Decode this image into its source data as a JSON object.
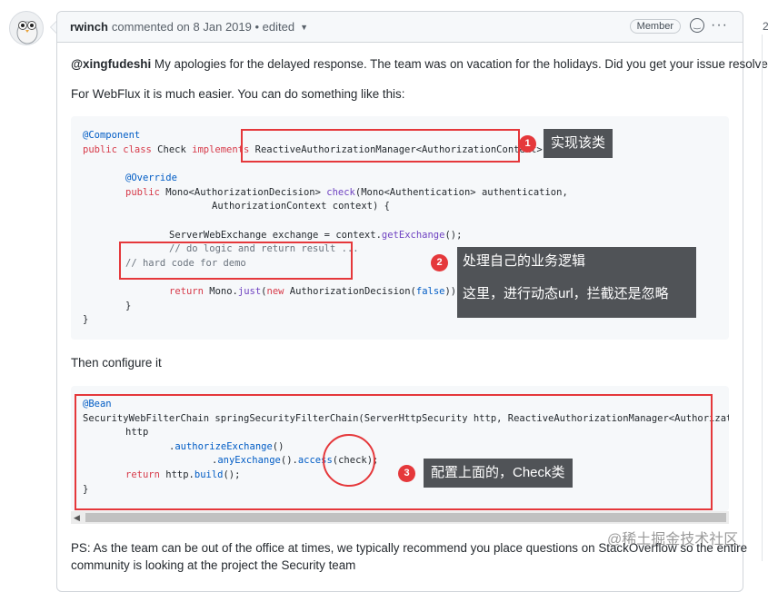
{
  "comment": {
    "author": "rwinch",
    "action": "commented on",
    "date": "8 Jan 2019",
    "edited": "• edited",
    "badge": "Member",
    "emoji_icon": "smiley-icon",
    "more_icon": "kebab-icon"
  },
  "body": {
    "p1_mention": "@xingfudeshi",
    "p1_text": " My apologies for the delayed response. The team was on vacation for the holidays. Did you get your issue resolved?",
    "p2": "For WebFlux it is much easier. You can do something like this:",
    "p3": "Then configure it",
    "p4_line1": "PS: As the team can be out of the office at times, we typically recommend you place questions on StackOverflow so the entire",
    "p4_line2": "community is looking at the project the Security team"
  },
  "code1": {
    "l1_anno": "@Component",
    "l2_kw": "public class",
    "l2_name": " Check ",
    "l2_impl": "implements",
    "l2_type": " ReactiveAuthorizationManager<AuthorizationContext> {",
    "l4_anno": "@Override",
    "l5_kw": "public",
    "l5_a": " Mono<AuthorizationDecision> ",
    "l5_fn": "check",
    "l5_b": "(Mono<Authentication> authentication,",
    "l6": "AuthorizationContext context) {",
    "l8_a": "ServerWebExchange exchange = context.",
    "l8_fn": "getExchange",
    "l8_b": "();",
    "l9": "// do logic and return result ...",
    "l10": "// hard code for demo",
    "l12_kw": "return",
    "l12_a": " Mono.",
    "l12_fn": "just",
    "l12_b": "(",
    "l12_new": "new",
    "l12_c": " AuthorizationDecision(",
    "l12_false": "false",
    "l12_d": "));",
    "l13": "}",
    "l14": "}"
  },
  "code2": {
    "l1": "@Bean",
    "l2": "SecurityWebFilterChain springSecurityFilterChain(ServerHttpSecurity http, ReactiveAuthorizationManager<AuthorizationCont",
    "l3": "http",
    "l4_dot": ".",
    "l4_fn": "authorizeExchange",
    "l4_b": "()",
    "l5_dot": ".",
    "l5_fn": "anyExchange",
    "l5_b": "().",
    "l5_fn2": "access",
    "l5_c": "(check);",
    "l6_kw": "return",
    "l6_a": " http.",
    "l6_fn": "build",
    "l6_b": "();",
    "l7": "}"
  },
  "annotations": {
    "n1": "1",
    "t1": "实现该类",
    "n2": "2",
    "t2_line1": "处理自己的业务逻辑",
    "t2_line2": "这里，进行动态url，拦截还是忽略",
    "n3": "3",
    "t3": "配置上面的，Check类"
  },
  "side": {
    "count": "2"
  },
  "watermark": "@稀土掘金技术社区",
  "colors": {
    "annotation_red": "#e5383b",
    "tooltip_bg": "#505357",
    "keyword": "#d73a49",
    "annotation": "#005cc5",
    "function": "#6f42c1"
  }
}
